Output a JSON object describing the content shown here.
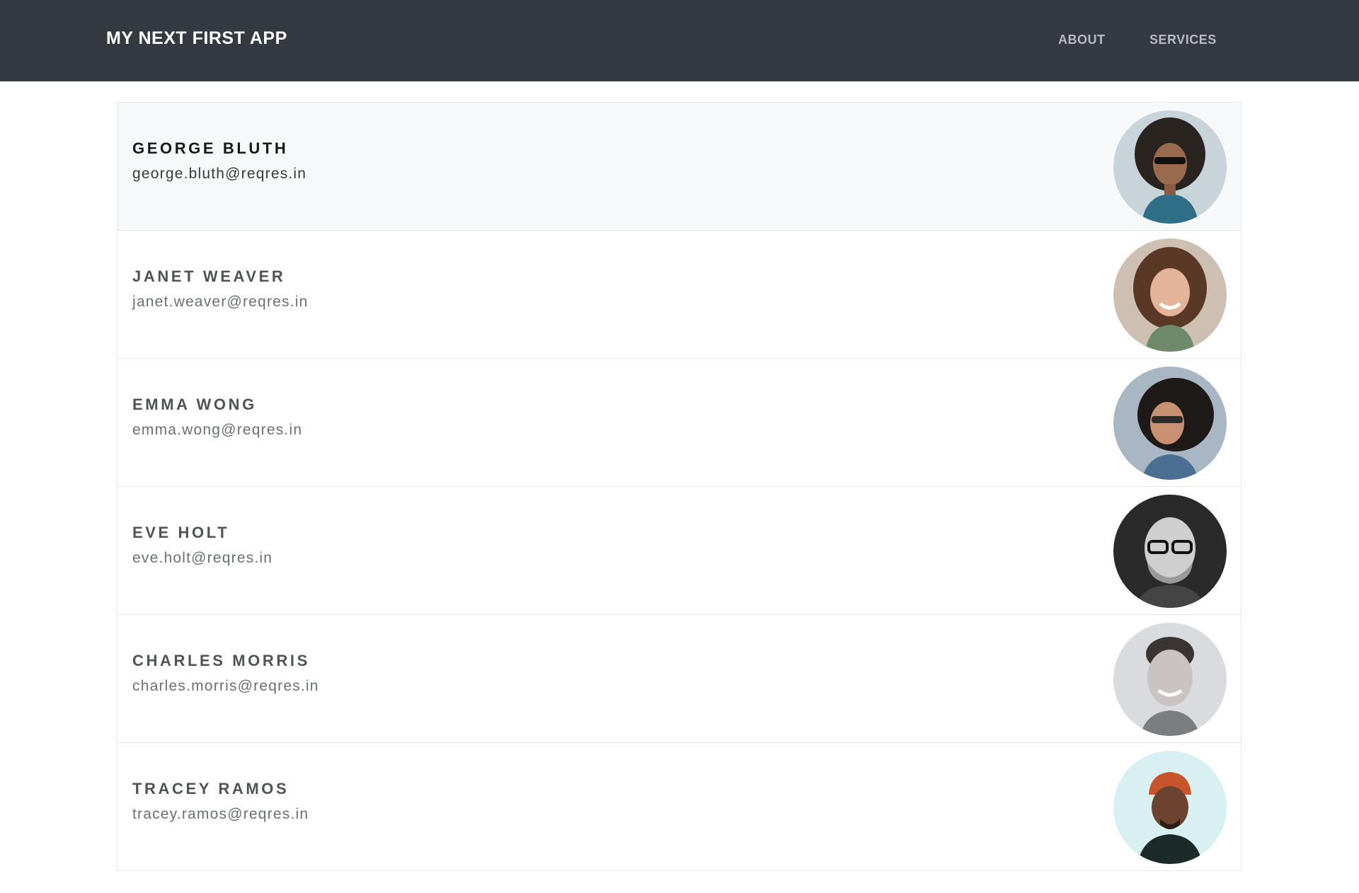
{
  "navbar": {
    "brand": "MY NEXT FIRST APP",
    "links": [
      {
        "label": "ABOUT"
      },
      {
        "label": "SERVICES"
      }
    ],
    "background": "#343a40"
  },
  "users": [
    {
      "name": "GEORGE BLUTH",
      "email": "george.bluth@reqres.in",
      "avatar_icon": "avatar-photo"
    },
    {
      "name": "JANET WEAVER",
      "email": "janet.weaver@reqres.in",
      "avatar_icon": "avatar-photo"
    },
    {
      "name": "EMMA WONG",
      "email": "emma.wong@reqres.in",
      "avatar_icon": "avatar-photo"
    },
    {
      "name": "EVE HOLT",
      "email": "eve.holt@reqres.in",
      "avatar_icon": "avatar-photo"
    },
    {
      "name": "CHARLES MORRIS",
      "email": "charles.morris@reqres.in",
      "avatar_icon": "avatar-photo"
    },
    {
      "name": "TRACEY RAMOS",
      "email": "tracey.ramos@reqres.in",
      "avatar_icon": "avatar-photo"
    }
  ]
}
